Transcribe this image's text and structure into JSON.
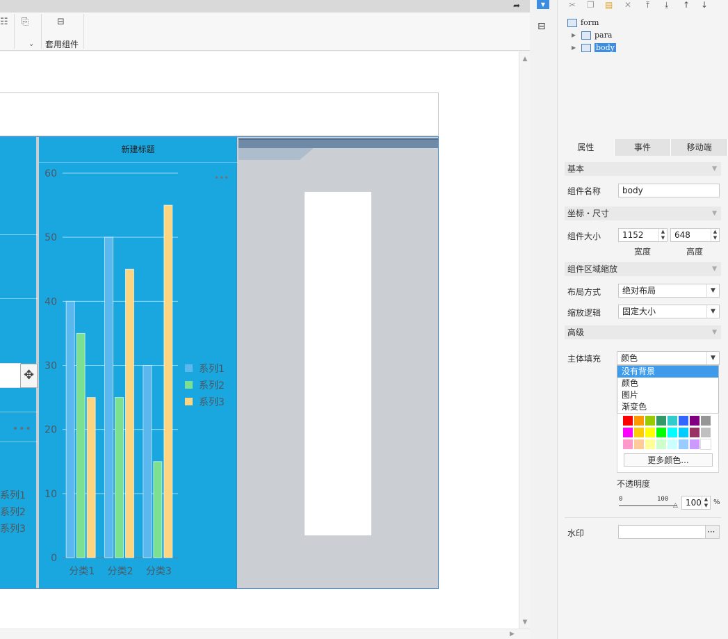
{
  "toolbar": {
    "preset_label": "套用组件"
  },
  "canvas": {
    "chart": {
      "title": "新建标题",
      "more": "•••",
      "legend_left": [
        "系列1",
        "系列2",
        "系列3"
      ]
    }
  },
  "chart_data": {
    "type": "bar",
    "categories": [
      "分类1",
      "分类2",
      "分类3"
    ],
    "series": [
      {
        "name": "系列1",
        "values": [
          40,
          50,
          30
        ],
        "color": "#5ab8ef"
      },
      {
        "name": "系列2",
        "values": [
          35,
          25,
          15
        ],
        "color": "#7be08f"
      },
      {
        "name": "系列3",
        "values": [
          25,
          45,
          55
        ],
        "color": "#fdd580"
      }
    ],
    "y_ticks": [
      0,
      10,
      20,
      30,
      40,
      50,
      60
    ],
    "ylim": [
      0,
      60
    ],
    "grid": true,
    "legend_position": "right"
  },
  "tree": {
    "root": "form",
    "children": [
      "para",
      "body"
    ],
    "selected": "body"
  },
  "panel": {
    "tabs": [
      "属性",
      "事件",
      "移动端"
    ],
    "section_basic": "基本",
    "component_name_label": "组件名称",
    "component_name_value": "body",
    "section_position": "坐标・尺寸",
    "size_label": "组件大小",
    "width_value": "1152",
    "height_value": "648",
    "width_label": "宽度",
    "height_label": "高度",
    "section_scale": "组件区域缩放",
    "layout_label": "布局方式",
    "layout_value": "绝对布局",
    "scale_label": "缩放逻辑",
    "scale_value": "固定大小",
    "section_advanced": "高级",
    "fill_label": "主体填充",
    "fill_value": "颜色",
    "fill_options": [
      "没有背景",
      "颜色",
      "图片",
      "渐变色"
    ],
    "palette_colors": [
      "#ff0000",
      "#ff9900",
      "#99cc00",
      "#339966",
      "#33cccc",
      "#3366ff",
      "#800080",
      "#969696",
      "#ff00ff",
      "#ffcc00",
      "#ffff00",
      "#00ff00",
      "#00ffff",
      "#00ccff",
      "#993366",
      "#c0c0c0",
      "#ff99cc",
      "#ffcc99",
      "#ffff99",
      "#ccffcc",
      "#ccffff",
      "#99ccff",
      "#cc99ff",
      "#ffffff"
    ],
    "more_colors": "更多颜色...",
    "opacity_label": "不透明度",
    "opacity_min": "0",
    "opacity_max": "100",
    "opacity_value": "100",
    "opacity_unit": "%",
    "watermark_label": "水印",
    "watermark_btn": "···"
  }
}
